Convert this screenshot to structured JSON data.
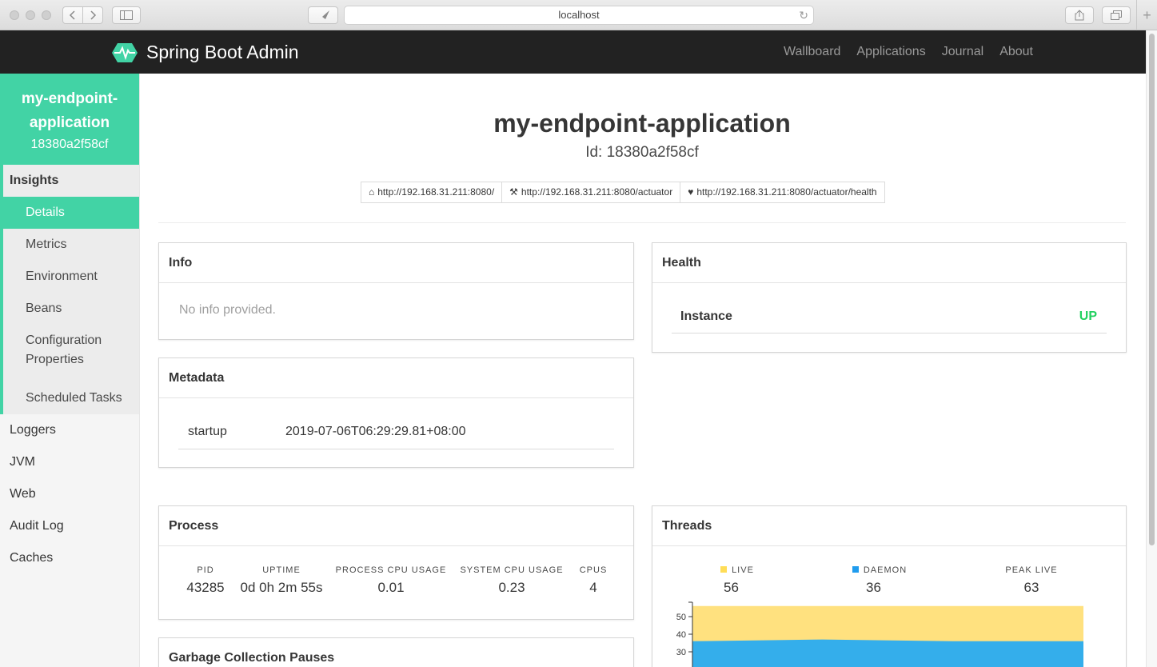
{
  "browser": {
    "url": "localhost",
    "reload_glyph": "↻",
    "new_tab_glyph": "+"
  },
  "navbar": {
    "brand": "Spring Boot Admin",
    "links": [
      "Wallboard",
      "Applications",
      "Journal",
      "About"
    ]
  },
  "sidebar": {
    "app_name": "my-endpoint-application",
    "app_id": "18380a2f58cf",
    "insights": {
      "title": "Insights",
      "items": [
        "Details",
        "Metrics",
        "Environment",
        "Beans",
        "Configuration Properties",
        "Scheduled Tasks"
      ],
      "active": "Details"
    },
    "items": [
      "Loggers",
      "JVM",
      "Web",
      "Audit Log",
      "Caches"
    ]
  },
  "header": {
    "title": "my-endpoint-application",
    "id_text": "Id: 18380a2f58cf",
    "links": [
      {
        "icon": "home-icon",
        "glyph": "⌂",
        "text": "http://192.168.31.211:8080/"
      },
      {
        "icon": "wrench-icon",
        "glyph": "⚒",
        "text": "http://192.168.31.211:8080/actuator"
      },
      {
        "icon": "heartbeat-icon",
        "glyph": "♥",
        "text": "http://192.168.31.211:8080/actuator/health"
      }
    ]
  },
  "info": {
    "title": "Info",
    "empty_text": "No info provided."
  },
  "metadata": {
    "title": "Metadata",
    "rows": [
      {
        "key": "startup",
        "value": "2019-07-06T06:29:29.81+08:00"
      }
    ]
  },
  "health": {
    "title": "Health",
    "label": "Instance",
    "status": "UP",
    "status_color": "#23d160"
  },
  "process": {
    "title": "Process",
    "stats": [
      {
        "label": "PID",
        "value": "43285"
      },
      {
        "label": "UPTIME",
        "value": "0d 0h 2m 55s"
      },
      {
        "label": "PROCESS CPU USAGE",
        "value": "0.01"
      },
      {
        "label": "SYSTEM CPU USAGE",
        "value": "0.23"
      },
      {
        "label": "CPUS",
        "value": "4"
      }
    ]
  },
  "gc": {
    "title": "Garbage Collection Pauses"
  },
  "threads": {
    "title": "Threads",
    "stats": [
      {
        "label": "LIVE",
        "value": "56",
        "color": "#ffdd57"
      },
      {
        "label": "DAEMON",
        "value": "36",
        "color": "#209cee"
      },
      {
        "label": "PEAK LIVE",
        "value": "63"
      }
    ]
  },
  "colors": {
    "accent": "#42d3a5",
    "navbar": "#222222",
    "live": "#ffe17f",
    "daemon": "#34aeeb"
  },
  "chart_data": {
    "type": "area",
    "yticks": [
      30,
      40,
      50
    ],
    "ylim": [
      0,
      57
    ],
    "series": [
      {
        "name": "LIVE",
        "values": [
          56,
          56,
          56,
          56
        ]
      },
      {
        "name": "DAEMON",
        "values": [
          36,
          37,
          36,
          36
        ]
      }
    ]
  }
}
